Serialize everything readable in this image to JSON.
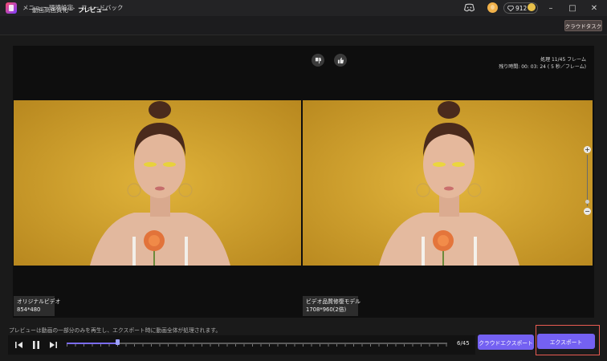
{
  "titlebar": {
    "menu": [
      "メニュー",
      "環境設定",
      "フィードバック"
    ],
    "credits": "912"
  },
  "nav": {
    "breadcrumb": [
      "動画高画質化",
      "プレビュー"
    ],
    "separator": ">",
    "cloud_task": "クラウドタスク"
  },
  "preview": {
    "status_frames": "処理 11/45 フレーム",
    "status_remaining": "残り時間: 00: 03: 24 ( 5 秒／フレーム)",
    "left": {
      "title": "オリジナルビデオ",
      "resolution": "854*480"
    },
    "right": {
      "title": "ビデオ品質修復モデル",
      "resolution": "1708*960(2倍)"
    },
    "zoom": {
      "plus": "+",
      "minus": "−",
      "level": 0.2
    }
  },
  "playback": {
    "notice": "プレビューは動画の一部分のみを再生し、エクスポート時に動画全体が処理されます。",
    "current_frame": 6,
    "total_frames": 45,
    "frame_label": "6/45"
  },
  "actions": {
    "cloud_export": "クラウドエクスポート",
    "export": "エクスポート"
  },
  "colors": {
    "accent": "#7461f2",
    "highlight": "#e85b52",
    "background": "#1a1a1a"
  }
}
